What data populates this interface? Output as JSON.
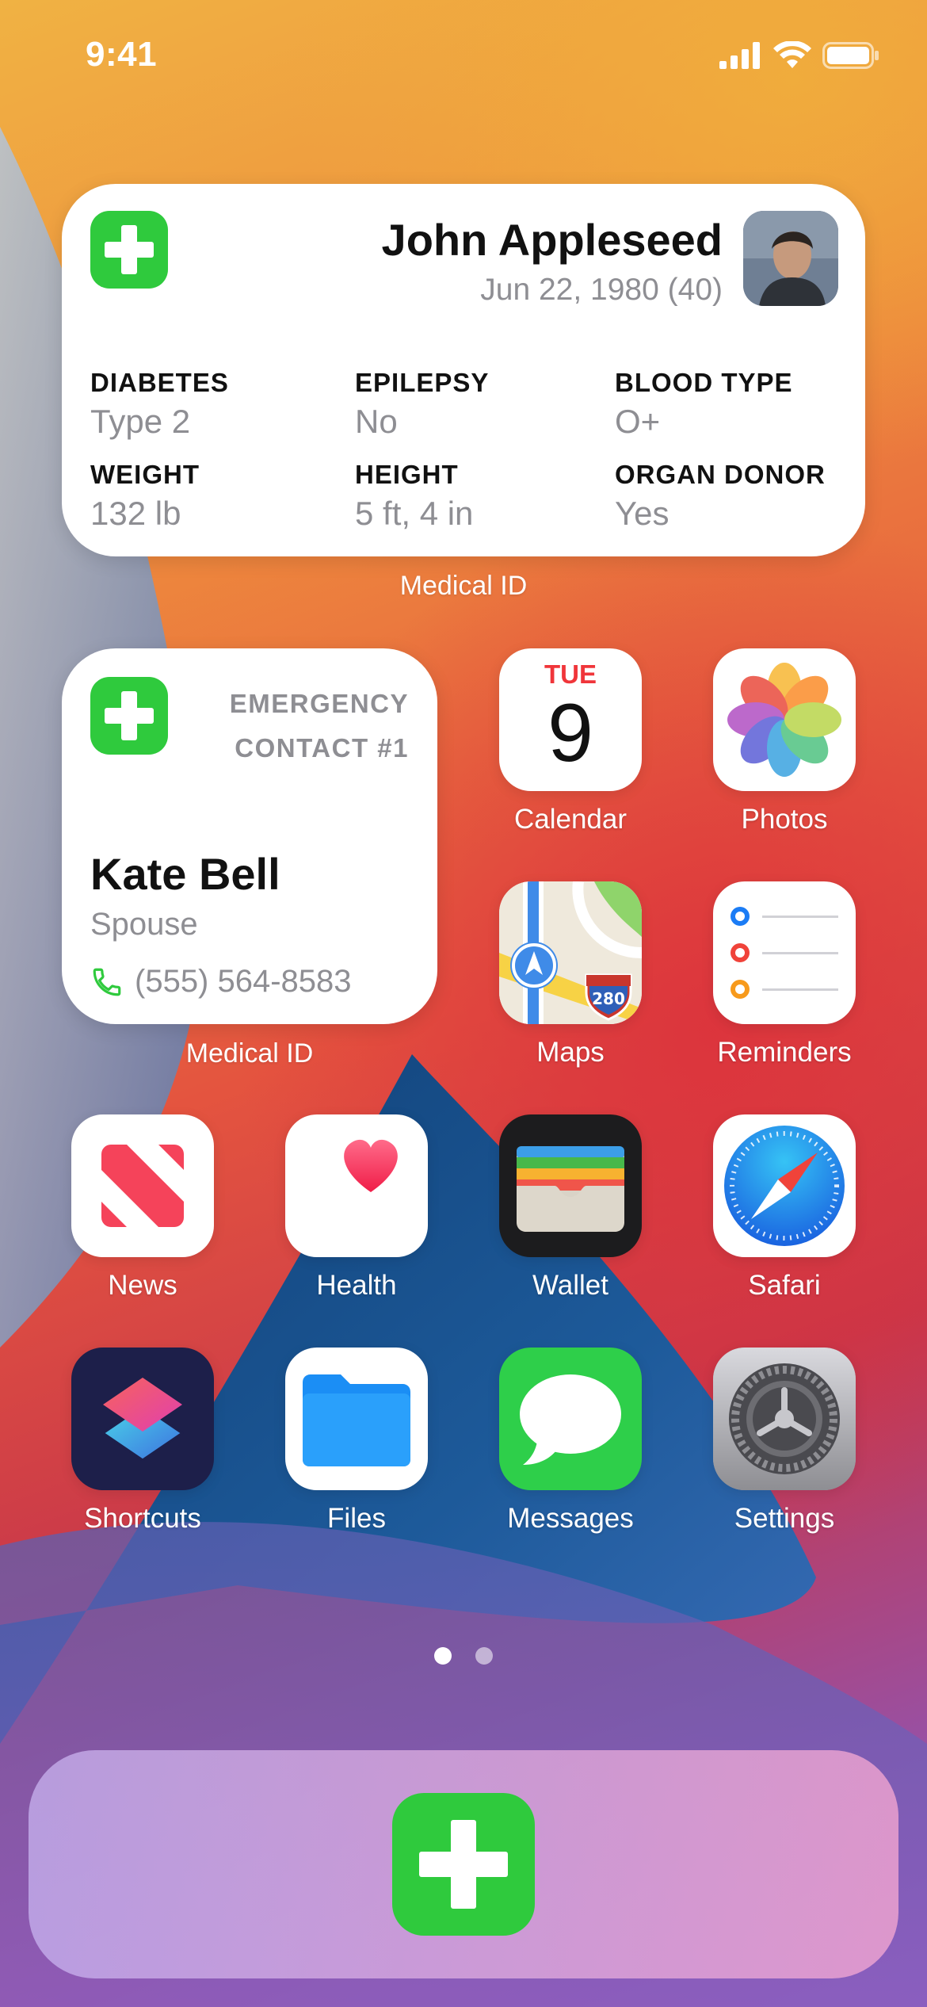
{
  "status_bar": {
    "time": "9:41",
    "icons": [
      "cellular-signal-icon",
      "wifi-icon",
      "battery-icon"
    ]
  },
  "medical_widget": {
    "name": "John Appleseed",
    "dob": "Jun 22, 1980 (40)",
    "fields": [
      {
        "key": "DIABETES",
        "value": "Type 2"
      },
      {
        "key": "EPILEPSY",
        "value": "No"
      },
      {
        "key": "BLOOD TYPE",
        "value": "O+"
      },
      {
        "key": "WEIGHT",
        "value": "132 lb"
      },
      {
        "key": "HEIGHT",
        "value": "5 ft, 4 in"
      },
      {
        "key": "ORGAN DONOR",
        "value": "Yes"
      }
    ],
    "label": "Medical ID"
  },
  "emergency_widget": {
    "heading_line1": "EMERGENCY",
    "heading_line2": "CONTACT #1",
    "name": "Kate Bell",
    "relation": "Spouse",
    "phone": "(555) 564-8583",
    "label": "Medical ID"
  },
  "apps": {
    "calendar": {
      "label": "Calendar",
      "day": "TUE",
      "date": "9"
    },
    "photos": {
      "label": "Photos"
    },
    "maps": {
      "label": "Maps",
      "shield": "280"
    },
    "reminders": {
      "label": "Reminders"
    },
    "news": {
      "label": "News"
    },
    "health": {
      "label": "Health"
    },
    "wallet": {
      "label": "Wallet"
    },
    "safari": {
      "label": "Safari"
    },
    "shortcuts": {
      "label": "Shortcuts"
    },
    "files": {
      "label": "Files"
    },
    "messages": {
      "label": "Messages"
    },
    "settings": {
      "label": "Settings"
    }
  },
  "page_indicator": {
    "pages": 2,
    "current": 1
  },
  "colors": {
    "medical_green": "#2fca3d",
    "calendar_red": "#f0353a"
  }
}
